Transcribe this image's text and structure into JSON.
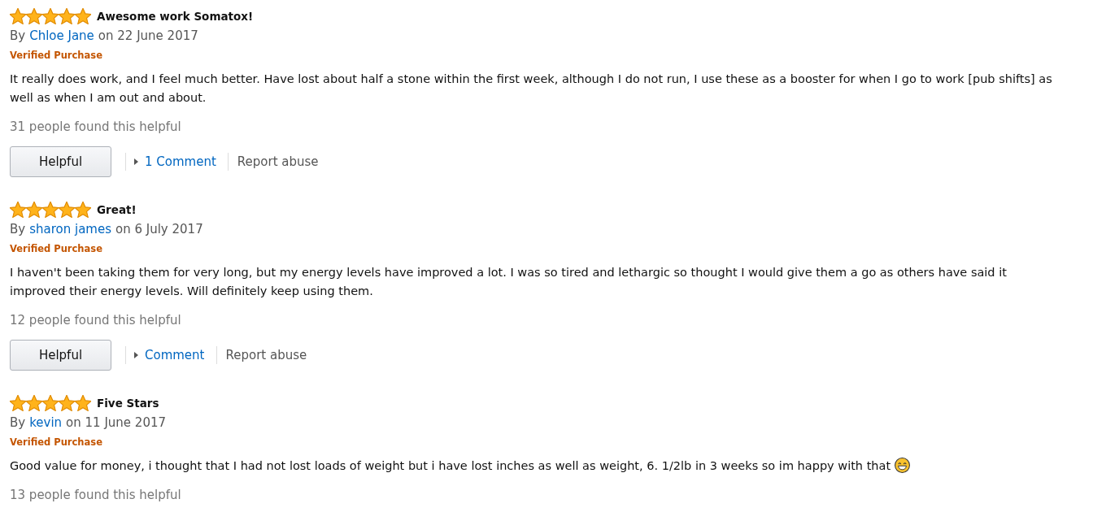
{
  "reviews": [
    {
      "stars": 5,
      "title": "Awesome work Somatox!",
      "by": "By",
      "author": "Chloe Jane",
      "date": "on 22 June 2017",
      "badge": "Verified Purchase",
      "body": "It really does work, and I feel much better. Have lost about half a stone within the first week, although I do not run, I use these as a booster for when I go to work [pub shifts] as well as when I am out and about.",
      "helpful_count": "31 people found this helpful",
      "actions": {
        "helpful_button": "Helpful",
        "comment_link": "1 Comment",
        "report_link": "Report abuse"
      }
    },
    {
      "stars": 5,
      "title": "Great!",
      "by": "By",
      "author": "sharon james",
      "date": "on 6 July 2017",
      "badge": "Verified Purchase",
      "body": "I haven't been taking them for very long, but my energy levels have improved a lot. I was so tired and lethargic so thought I would give them a go as others have said it improved their energy levels. Will definitely keep using them.",
      "helpful_count": "12 people found this helpful",
      "actions": {
        "helpful_button": "Helpful",
        "comment_link": "Comment",
        "report_link": "Report abuse"
      }
    },
    {
      "stars": 5,
      "title": "Five Stars",
      "by": "By",
      "author": "kevin",
      "date": "on 11 June 2017",
      "badge": "Verified Purchase",
      "body": "Good value for money, i thought that I had not lost loads of weight but i have lost inches as well as weight, 6. 1/2lb in 3 weeks so im happy with that",
      "emoji": true,
      "helpful_count": "13 people found this helpful"
    }
  ]
}
